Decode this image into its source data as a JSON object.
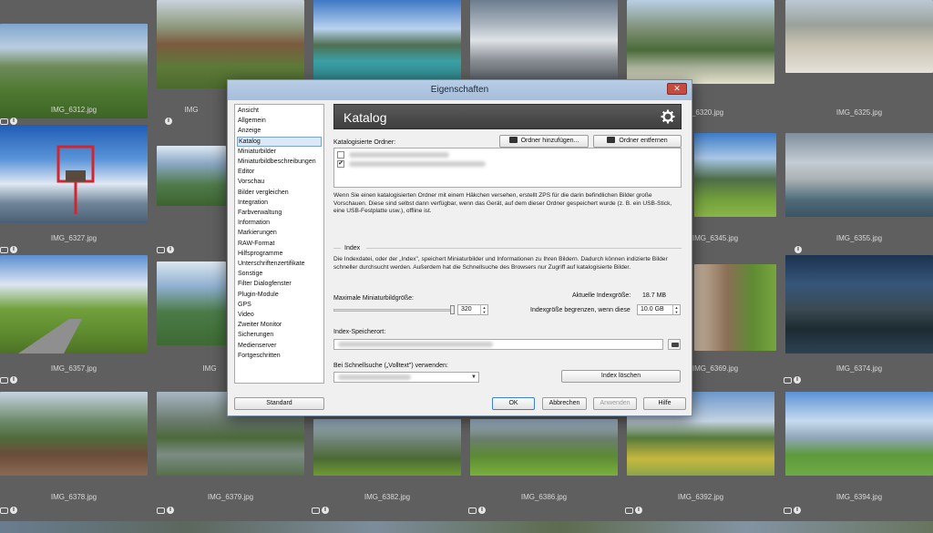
{
  "thumbnails": {
    "row1": [
      "IMG_6312.jpg",
      "IMG",
      "",
      "",
      "IMG_6320.jpg",
      "IMG_6325.jpg"
    ],
    "row2": [
      "IMG_6327.jpg",
      "",
      "",
      "",
      "IMG_6345.jpg",
      "IMG_6355.jpg"
    ],
    "row3": [
      "IMG_6357.jpg",
      "IMG",
      "",
      "",
      "IMG_6369.jpg",
      "IMG_6374.jpg"
    ],
    "row4": [
      "IMG_6378.jpg",
      "IMG_6379.jpg",
      "IMG_6382.jpg",
      "IMG_6386.jpg",
      "IMG_6392.jpg",
      "IMG_6394.jpg"
    ]
  },
  "dialog": {
    "title": "Eigenschaften",
    "close_glyph": "✕",
    "nav_items": [
      "Ansicht",
      "Allgemein",
      "Anzeige",
      "Katalog",
      "Miniaturbilder",
      "Miniaturbildbeschreibungen",
      "Editor",
      "Vorschau",
      "Bilder vergleichen",
      "Integration",
      "Farbverwaltung",
      "Information",
      "Markierungen",
      "RAW-Format",
      "Hilfsprogramme",
      "Unterschriftenzertifikate",
      "Sonstige",
      "Filter Dialogfenster",
      "Plugin-Module",
      "GPS",
      "Video",
      "Zweiter Monitor",
      "Sicherungen",
      "Medienserver",
      "Fortgeschritten"
    ],
    "selected_nav": "Katalog",
    "panel_title": "Katalog",
    "catalog_folders_label": "Katalogisierte Ordner:",
    "add_folder_label": "Ordner hinzufügen...",
    "remove_folder_label": "Ordner entfernen",
    "folder_checks": [
      "",
      "✔"
    ],
    "catalog_description": "Wenn Sie einen katalogisierten Ordner mit einem Häkchen versehen, erstellt ZPS für die darin befindlichen Bilder große Vorschauen. Diese sind selbst dann verfügbar, wenn das Gerät, auf dem dieser Ordner gespeichert wurde (z. B. ein USB-Stick, eine USB-Festplatte usw.), offline ist.",
    "index_section_label": "Index",
    "index_description": "Die Indexdatei, oder der „Index\", speichert Miniaturbilder und Informationen zu Ihren Bildern. Dadurch können indizierte Bilder schneller durchsucht werden. Außerdem hat die Schnellsuche des Browsers nur Zugriff auf katalogisierte Bilder.",
    "max_thumb_size_label": "Maximale Miniaturbildgröße:",
    "max_thumb_size_value": "320",
    "current_index_size_label": "Aktuelle Indexgröße:",
    "current_index_size_value": "18.7 MB",
    "limit_index_label": "Indexgröße begrenzen, wenn diese",
    "limit_index_value": "10.0 GB",
    "index_location_label": "Index-Speicherort:",
    "quicksearch_label": "Bei Schnellsuche („Volltext\") verwenden:",
    "delete_index_label": "Index löschen",
    "standard_label": "Standard",
    "ok_label": "OK",
    "cancel_label": "Abbrechen",
    "apply_label": "Anwenden",
    "help_label": "Hilfe"
  },
  "colors": {
    "titlebar": "#a6bedb",
    "close": "#c64a3e",
    "panel_header": "#444444",
    "selection": "#dbe8f8"
  }
}
